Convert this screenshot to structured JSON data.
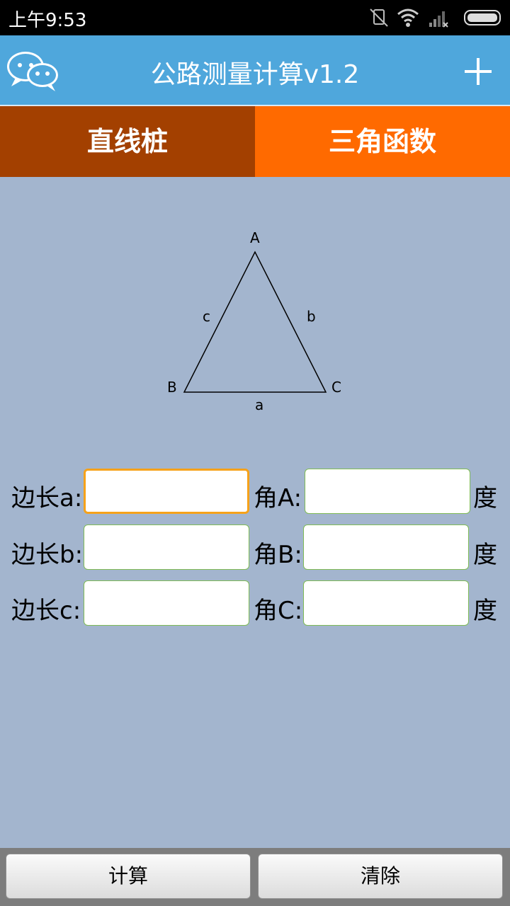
{
  "status_bar": {
    "time": "上午9:53",
    "icons": [
      "mute-icon",
      "wifi-icon",
      "signal-icon",
      "battery-icon"
    ]
  },
  "header": {
    "title": "公路测量计算v1.2",
    "logo_icon": "chat-bubbles-icon",
    "add_icon": "plus-icon"
  },
  "tabs": [
    {
      "label": "直线桩",
      "color": "#a34000"
    },
    {
      "label": "三角函数",
      "color": "#ff6a00"
    }
  ],
  "diagram": {
    "vertices": [
      "A",
      "B",
      "C"
    ],
    "sides": [
      "a",
      "b",
      "c"
    ]
  },
  "form": {
    "rows": [
      {
        "side_label": "边长a:",
        "side_value": "",
        "angle_label": "角A:",
        "angle_value": "",
        "unit": "度"
      },
      {
        "side_label": "边长b:",
        "side_value": "",
        "angle_label": "角B:",
        "angle_value": "",
        "unit": "度"
      },
      {
        "side_label": "边长c:",
        "side_value": "",
        "angle_label": "角C:",
        "angle_value": "",
        "unit": "度"
      }
    ]
  },
  "buttons": {
    "calculate": "计算",
    "clear": "清除"
  },
  "colors": {
    "header_bg": "#4fa7dc",
    "content_bg": "#a3b5ce",
    "focus_border": "#f6a21a",
    "input_border": "#7fbb55"
  }
}
